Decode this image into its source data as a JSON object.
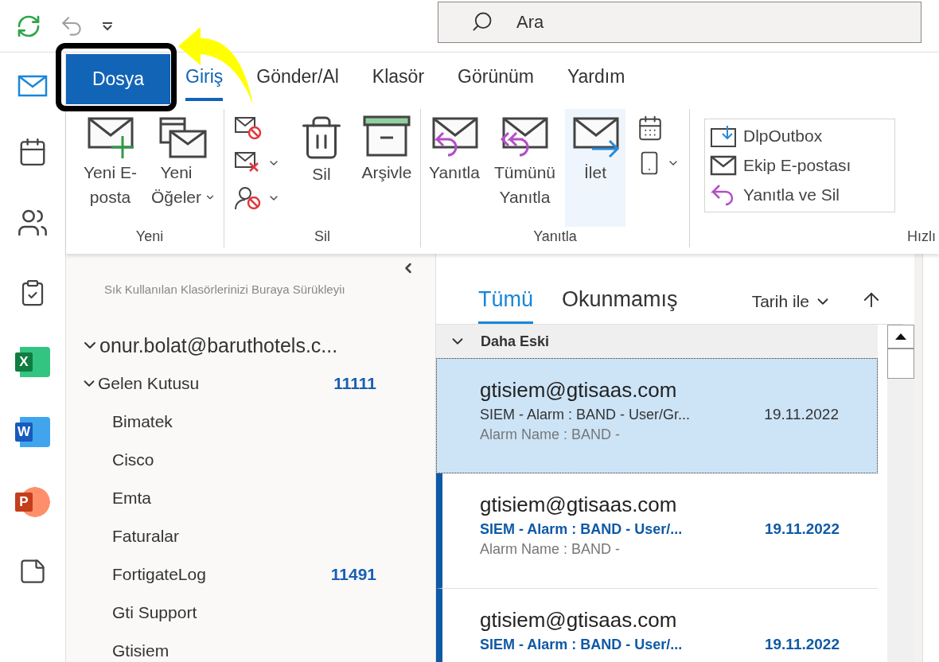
{
  "quick_access": [
    {
      "kind": "sync",
      "disabled": false
    },
    {
      "kind": "undo",
      "disabled": true
    },
    {
      "kind": "customize",
      "disabled": false
    }
  ],
  "search": {
    "placeholder": "Ara"
  },
  "ribbon_tabs": [
    {
      "label": "Dosya",
      "kind": "file",
      "selected": false
    },
    {
      "label": "Giriş",
      "kind": "tab",
      "selected": true
    },
    {
      "label": "Gönder/Al",
      "kind": "tab",
      "selected": false
    },
    {
      "label": "Klasör",
      "kind": "tab",
      "selected": false
    },
    {
      "label": "Görünüm",
      "kind": "tab",
      "selected": false
    },
    {
      "label": "Yardım",
      "kind": "tab",
      "selected": false
    }
  ],
  "nav_rail": [
    {
      "kind": "mail",
      "selected": true
    },
    {
      "kind": "calendar",
      "selected": false
    },
    {
      "kind": "people",
      "selected": false
    },
    {
      "kind": "tasks",
      "selected": false
    },
    {
      "kind": "excel",
      "letter": "X",
      "selected": false
    },
    {
      "kind": "word",
      "letter": "W",
      "selected": false
    },
    {
      "kind": "powerpoint",
      "letter": "P",
      "selected": false
    },
    {
      "kind": "notes",
      "selected": false
    }
  ],
  "ribbon_groups": [
    {
      "label": "Yeni",
      "commands": [
        {
          "kind": "large",
          "label": "Yeni E-\nposta",
          "dropdown": false,
          "highlighted": false
        },
        {
          "kind": "large",
          "label": "Yeni\nÖğeler",
          "dropdown": true,
          "highlighted": false
        }
      ]
    },
    {
      "label": "Sil",
      "commands": [
        {
          "kind": "stack",
          "items": [
            {
              "dropdown": false
            },
            {
              "dropdown": true
            },
            {
              "dropdown": true
            }
          ]
        },
        {
          "kind": "large",
          "label": "Sil",
          "dropdown": false,
          "highlighted": false
        },
        {
          "kind": "large",
          "label": "Arşivle",
          "dropdown": false,
          "highlighted": false
        }
      ]
    },
    {
      "label": "Yanıtla",
      "commands": [
        {
          "kind": "large",
          "label": "Yanıtla",
          "dropdown": false,
          "highlighted": false
        },
        {
          "kind": "large",
          "label": "Tümünü\nYanıtla",
          "dropdown": false,
          "highlighted": false
        },
        {
          "kind": "large",
          "label": "İlet",
          "dropdown": false,
          "highlighted": true
        },
        {
          "kind": "stack",
          "items": [
            {
              "dropdown": false
            },
            {
              "dropdown": true
            }
          ]
        }
      ]
    },
    {
      "label": "Hızlı",
      "commands": [
        {
          "kind": "quick_steps",
          "items": [
            {
              "label": "DlpOutbox"
            },
            {
              "label": "Ekip E-postası"
            },
            {
              "label": "Yanıtla ve Sil"
            }
          ]
        }
      ]
    }
  ],
  "folder_pane": {
    "hint": "Sık Kullanılan Klasörlerinizi Buraya Sürükleyiı",
    "accounts": [
      {
        "label": "onur.bolat@baruthotels.c...",
        "expanded": true,
        "children": [
          {
            "label": "Gelen Kutusu",
            "count": "11111",
            "expanded": true,
            "children": [
              {
                "label": "Bimatek"
              },
              {
                "label": "Cisco"
              },
              {
                "label": "Emta"
              },
              {
                "label": "Faturalar"
              },
              {
                "label": "FortigateLog",
                "count": "11491"
              },
              {
                "label": "Gti Support"
              },
              {
                "label": "Gtisiem"
              }
            ]
          }
        ]
      }
    ]
  },
  "message_list": {
    "filters": [
      {
        "label": "Tümü",
        "selected": true
      },
      {
        "label": "Okunmamış",
        "selected": false
      }
    ],
    "sort": {
      "label": "Tarih ile"
    },
    "group": {
      "label": "Daha Eski",
      "expanded": true
    },
    "messages": [
      {
        "sender": "gtisiem@gtisaas.com",
        "subject": "SIEM - Alarm : BAND - User/Gr...",
        "date": "19.11.2022",
        "preview": "Alarm Name : BAND -",
        "selected": true,
        "unread": false
      },
      {
        "sender": "gtisiem@gtisaas.com",
        "subject": "SIEM - Alarm : BAND - User/...",
        "date": "19.11.2022",
        "preview": "Alarm Name : BAND -",
        "selected": false,
        "unread": true
      },
      {
        "sender": "gtisiem@gtisaas.com",
        "subject": "SIEM - Alarm : BAND - User/...",
        "date": "19.11.2022",
        "selected": false,
        "unread": true
      }
    ]
  }
}
